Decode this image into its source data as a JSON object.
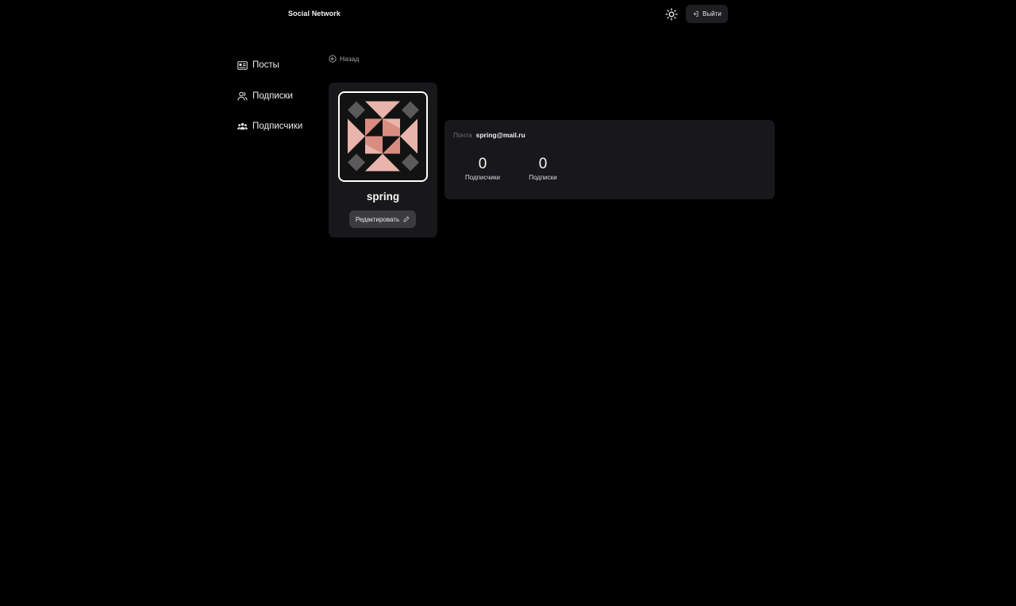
{
  "header": {
    "brand": "Social Network",
    "logout_label": "Выйти"
  },
  "sidebar": {
    "items": [
      {
        "label": "Посты",
        "icon": "newspaper-icon"
      },
      {
        "label": "Подписки",
        "icon": "users-outline-icon"
      },
      {
        "label": "Подписчики",
        "icon": "users-solid-icon"
      }
    ]
  },
  "back": {
    "label": "Назад"
  },
  "profile": {
    "username": "spring",
    "edit_label": "Редактировать",
    "email_label": "Почта",
    "email": "spring@mail.ru",
    "stats": {
      "followers_count": "0",
      "followers_label": "Подписчики",
      "following_count": "0",
      "following_label": "Подписки"
    }
  },
  "colors": {
    "background": "#000000",
    "card": "#18181b",
    "button": "#3b3b40",
    "avatar_pink_light": "#e8b4ac",
    "avatar_pink_dark": "#d98d80",
    "avatar_grey": "#5a5a5a"
  }
}
